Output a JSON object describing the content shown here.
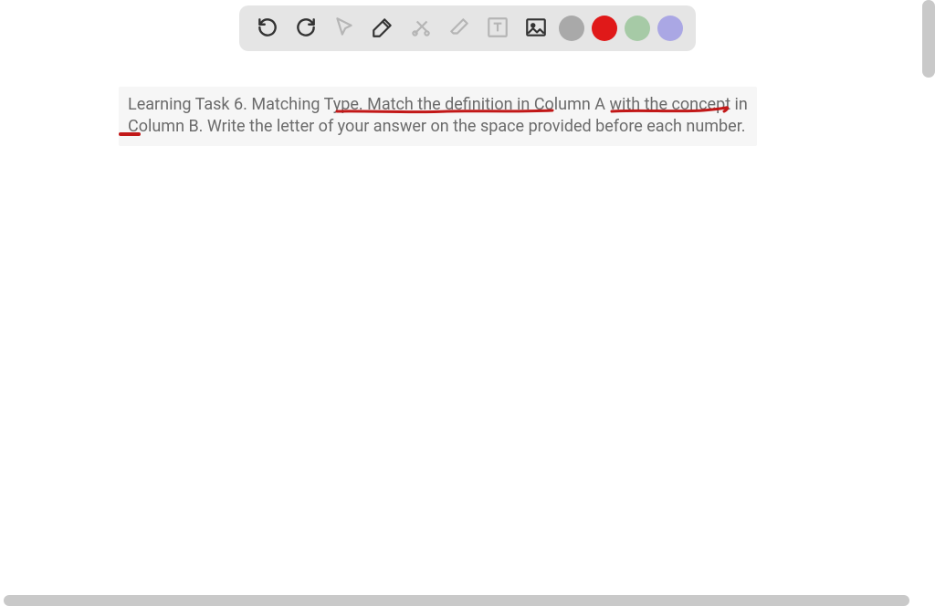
{
  "toolbar": {
    "undo_label": "Undo",
    "redo_label": "Redo",
    "pointer_label": "Pointer",
    "pen_label": "Pen",
    "tools_label": "Tools",
    "eraser_label": "Eraser",
    "text_label": "Text",
    "image_label": "Image"
  },
  "colors": {
    "gray": "#a9a9a9",
    "red": "#e01919",
    "green": "#a6caa6",
    "purple": "#aaa7e4",
    "annotation_red": "#c21818"
  },
  "content": {
    "instruction": "Learning Task 6. Matching Type. Match the definition in Column A with the concept in Column B. Write the letter of your answer on the space provided before each number."
  }
}
